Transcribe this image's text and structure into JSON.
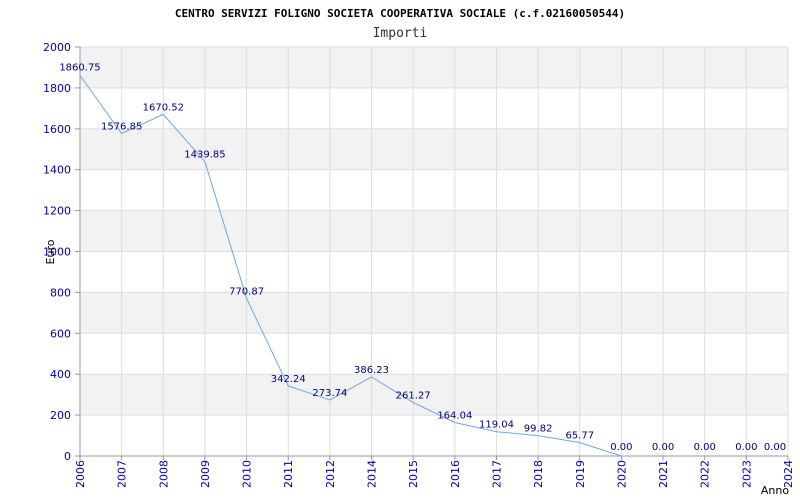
{
  "colors": {
    "background": "#ffffff",
    "band": "#f2f2f2",
    "grid": "#dddddd",
    "line": "#6aa9e6",
    "ticks": "#0000aa",
    "data_labels": "#000080"
  },
  "chart_data": {
    "type": "line",
    "title": "CENTRO SERVIZI FOLIGNO SOCIETA COOPERATIVA SOCIALE (c.f.02160050544)",
    "subtitle": "Importi",
    "xlabel": "Anno",
    "ylabel": "Euro",
    "ylim": [
      0,
      2000
    ],
    "y_ticks": [
      "0",
      "200",
      "400",
      "600",
      "800",
      "1000",
      "1200",
      "1400",
      "1600",
      "1800",
      "2000"
    ],
    "x": [
      "2006",
      "2007",
      "2008",
      "2009",
      "2010",
      "2011",
      "2012",
      "2014",
      "2015",
      "2016",
      "2017",
      "2018",
      "2019",
      "2020",
      "2021",
      "2022",
      "2023",
      "2024"
    ],
    "values": [
      1860.75,
      1576.85,
      1670.52,
      1439.85,
      770.87,
      342.24,
      273.74,
      386.23,
      261.27,
      164.04,
      119.04,
      99.82,
      65.77,
      0.0,
      null,
      null,
      null,
      null
    ],
    "data_labels": [
      "1860.75",
      "1576.85",
      "1670.52",
      "1439.85",
      "770.87",
      "342.24",
      "273.74",
      "386.23",
      "261.27",
      "164.04",
      "119.04",
      "99.82",
      "65.77",
      "0.00",
      "0.00",
      "0.00",
      "0.00",
      "0.00"
    ],
    "grid": true,
    "legend": "none"
  }
}
